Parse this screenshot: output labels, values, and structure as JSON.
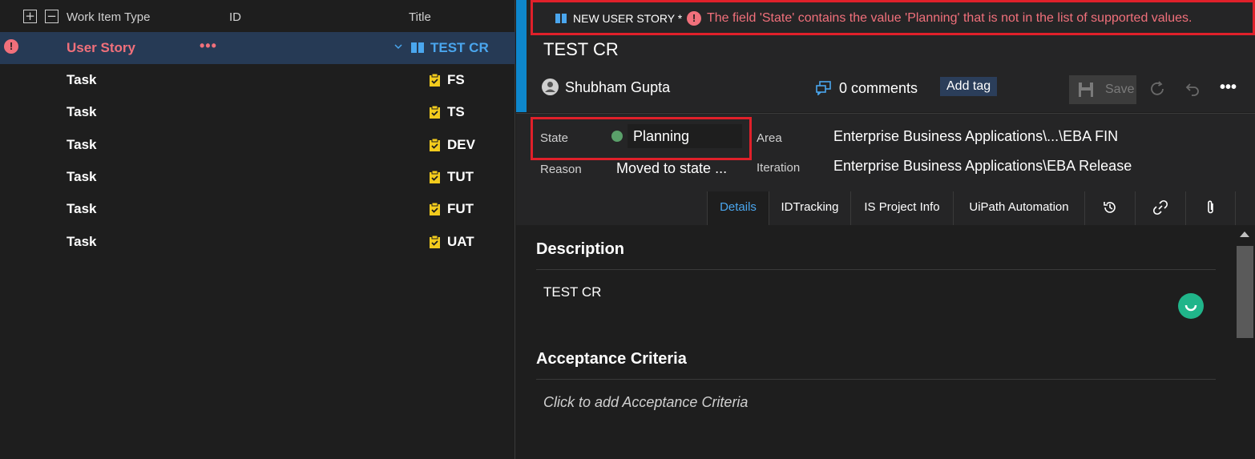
{
  "grid": {
    "header": {
      "expand_icon": "plus-box-icon",
      "collapse_icon": "minus-box-icon",
      "columns": [
        "Work Item Type",
        "ID",
        "Title"
      ]
    },
    "rows": [
      {
        "type": "User Story",
        "title": "TEST CR",
        "error": true
      },
      {
        "type": "Task",
        "title": "FS"
      },
      {
        "type": "Task",
        "title": "TS"
      },
      {
        "type": "Task",
        "title": "DEV"
      },
      {
        "type": "Task",
        "title": "TUT"
      },
      {
        "type": "Task",
        "title": "FUT"
      },
      {
        "type": "Task",
        "title": "UAT"
      }
    ],
    "error_glyph": "!",
    "more_glyph": "•••"
  },
  "panel": {
    "kind_label": "NEW USER STORY *",
    "error_message": "The field 'State' contains the value 'Planning' that is not in the list of supported values.",
    "title": "TEST CR",
    "assignee": "Shubham Gupta",
    "comments": "0 comments",
    "add_tag": "Add tag",
    "save": "Save",
    "more": "•••",
    "fields": {
      "state_label": "State",
      "state_value": "Planning",
      "reason_label": "Reason",
      "reason_value": "Moved to state ...",
      "area_label": "Area",
      "area_value": "Enterprise Business Applications\\...\\EBA FIN",
      "iteration_label": "Iteration",
      "iteration_value": "Enterprise Business Applications\\EBA Release"
    },
    "tabs": [
      "Details",
      "IDTracking",
      "IS Project Info",
      "UiPath Automation"
    ],
    "tab_icons": [
      "history-icon",
      "link-icon",
      "attachment-icon"
    ],
    "sections": {
      "description_title": "Description",
      "description_text": "TEST CR",
      "acceptance_title": "Acceptance Criteria",
      "acceptance_placeholder": "Click to add Acceptance Criteria"
    }
  },
  "colors": {
    "accent": "#0e87cc",
    "error": "#f1707b",
    "selected_row": "#263a55",
    "task_yellow": "#f2cb1d",
    "state_green": "#5aa06a"
  }
}
